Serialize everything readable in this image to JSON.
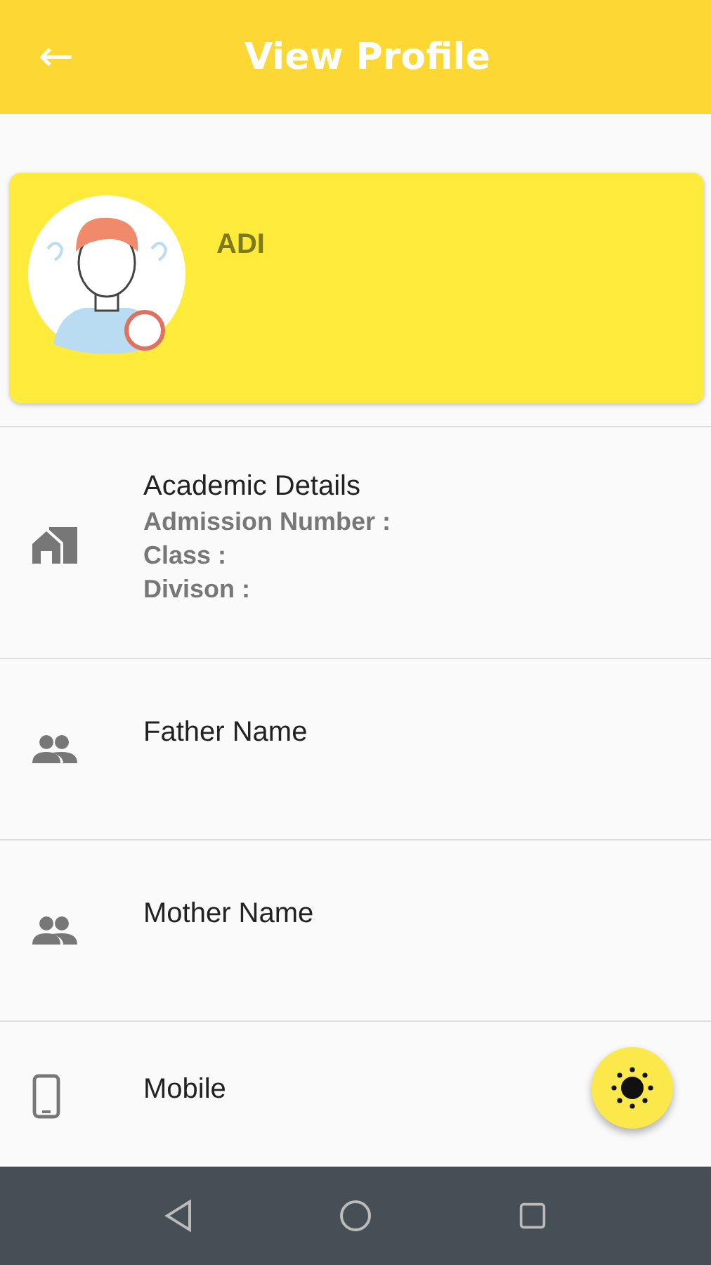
{
  "app_bar": {
    "back": "←",
    "title": "View Profile"
  },
  "profile": {
    "name": "ADI"
  },
  "rows": [
    {
      "kind": "academic",
      "title": "Academic Details",
      "lines": [
        "Admission Number :",
        "Class :",
        "Divison :"
      ]
    },
    {
      "kind": "parent",
      "title": "Father Name"
    },
    {
      "kind": "parent",
      "title": "Mother Name"
    },
    {
      "kind": "mobile",
      "title": "Mobile"
    }
  ]
}
